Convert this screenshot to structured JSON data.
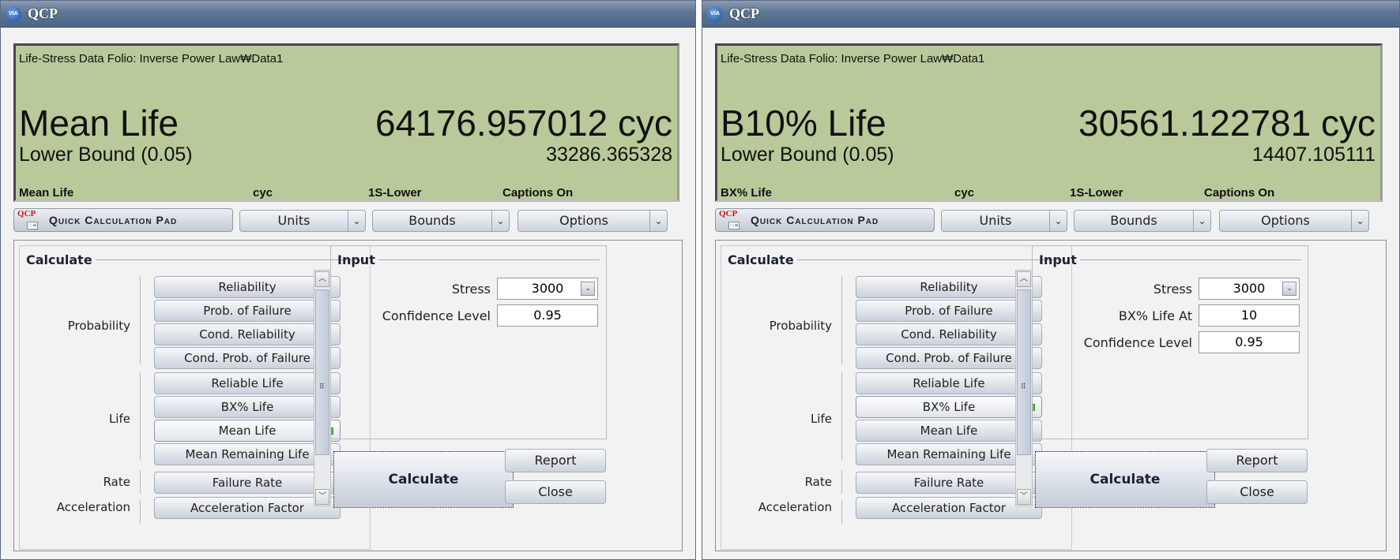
{
  "windows": [
    {
      "title": "QCP",
      "logo_text": "VIA",
      "lcd": {
        "folio": "Life-Stress Data Folio: Inverse Power Law₩Data1",
        "metric_name": "Mean Life",
        "metric_value": "64176.957012 cyc",
        "bound_label": "Lower Bound (0.05)",
        "bound_value": "33286.365328",
        "captions": [
          "Mean Life",
          "cyc",
          "1S-Lower",
          "Captions On"
        ]
      },
      "toolbar": {
        "qcp_icon_text": "QCP",
        "qcp_label": "Quick Calculation Pad",
        "units": "Units",
        "bounds": "Bounds",
        "options": "Options"
      },
      "calculate": {
        "header": "Calculate",
        "groups": [
          {
            "label": "Probability",
            "buttons": [
              "Reliability",
              "Prob. of Failure",
              "Cond. Reliability",
              "Cond. Prob. of Failure"
            ]
          },
          {
            "label": "Life",
            "buttons": [
              "Reliable Life",
              "BX% Life",
              "Mean Life",
              "Mean Remaining Life"
            ]
          },
          {
            "label": "Rate",
            "buttons": [
              "Failure Rate"
            ]
          },
          {
            "label": "Acceleration",
            "buttons": [
              "Acceleration Factor"
            ]
          }
        ],
        "selected": "Mean Life"
      },
      "input": {
        "header": "Input",
        "fields": [
          {
            "label": "Stress",
            "value": "3000",
            "dropdown": true
          },
          {
            "label": "Confidence Level",
            "value": "0.95",
            "dropdown": false
          }
        ]
      },
      "actions": {
        "calculate": "Calculate",
        "report": "Report",
        "close": "Close"
      }
    },
    {
      "title": "QCP",
      "logo_text": "VIA",
      "lcd": {
        "folio": "Life-Stress Data Folio: Inverse Power Law₩Data1",
        "metric_name": "B10% Life",
        "metric_value": "30561.122781 cyc",
        "bound_label": "Lower Bound (0.05)",
        "bound_value": "14407.105111",
        "captions": [
          "BX% Life",
          "cyc",
          "1S-Lower",
          "Captions On"
        ]
      },
      "toolbar": {
        "qcp_icon_text": "QCP",
        "qcp_label": "Quick Calculation Pad",
        "units": "Units",
        "bounds": "Bounds",
        "options": "Options"
      },
      "calculate": {
        "header": "Calculate",
        "groups": [
          {
            "label": "Probability",
            "buttons": [
              "Reliability",
              "Prob. of Failure",
              "Cond. Reliability",
              "Cond. Prob. of Failure"
            ]
          },
          {
            "label": "Life",
            "buttons": [
              "Reliable Life",
              "BX% Life",
              "Mean Life",
              "Mean Remaining Life"
            ]
          },
          {
            "label": "Rate",
            "buttons": [
              "Failure Rate"
            ]
          },
          {
            "label": "Acceleration",
            "buttons": [
              "Acceleration Factor"
            ]
          }
        ],
        "selected": "BX% Life"
      },
      "input": {
        "header": "Input",
        "fields": [
          {
            "label": "Stress",
            "value": "3000",
            "dropdown": true
          },
          {
            "label": "BX% Life At",
            "value": "10",
            "dropdown": false
          },
          {
            "label": "Confidence Level",
            "value": "0.95",
            "dropdown": false
          }
        ]
      },
      "actions": {
        "calculate": "Calculate",
        "report": "Report",
        "close": "Close"
      }
    }
  ]
}
